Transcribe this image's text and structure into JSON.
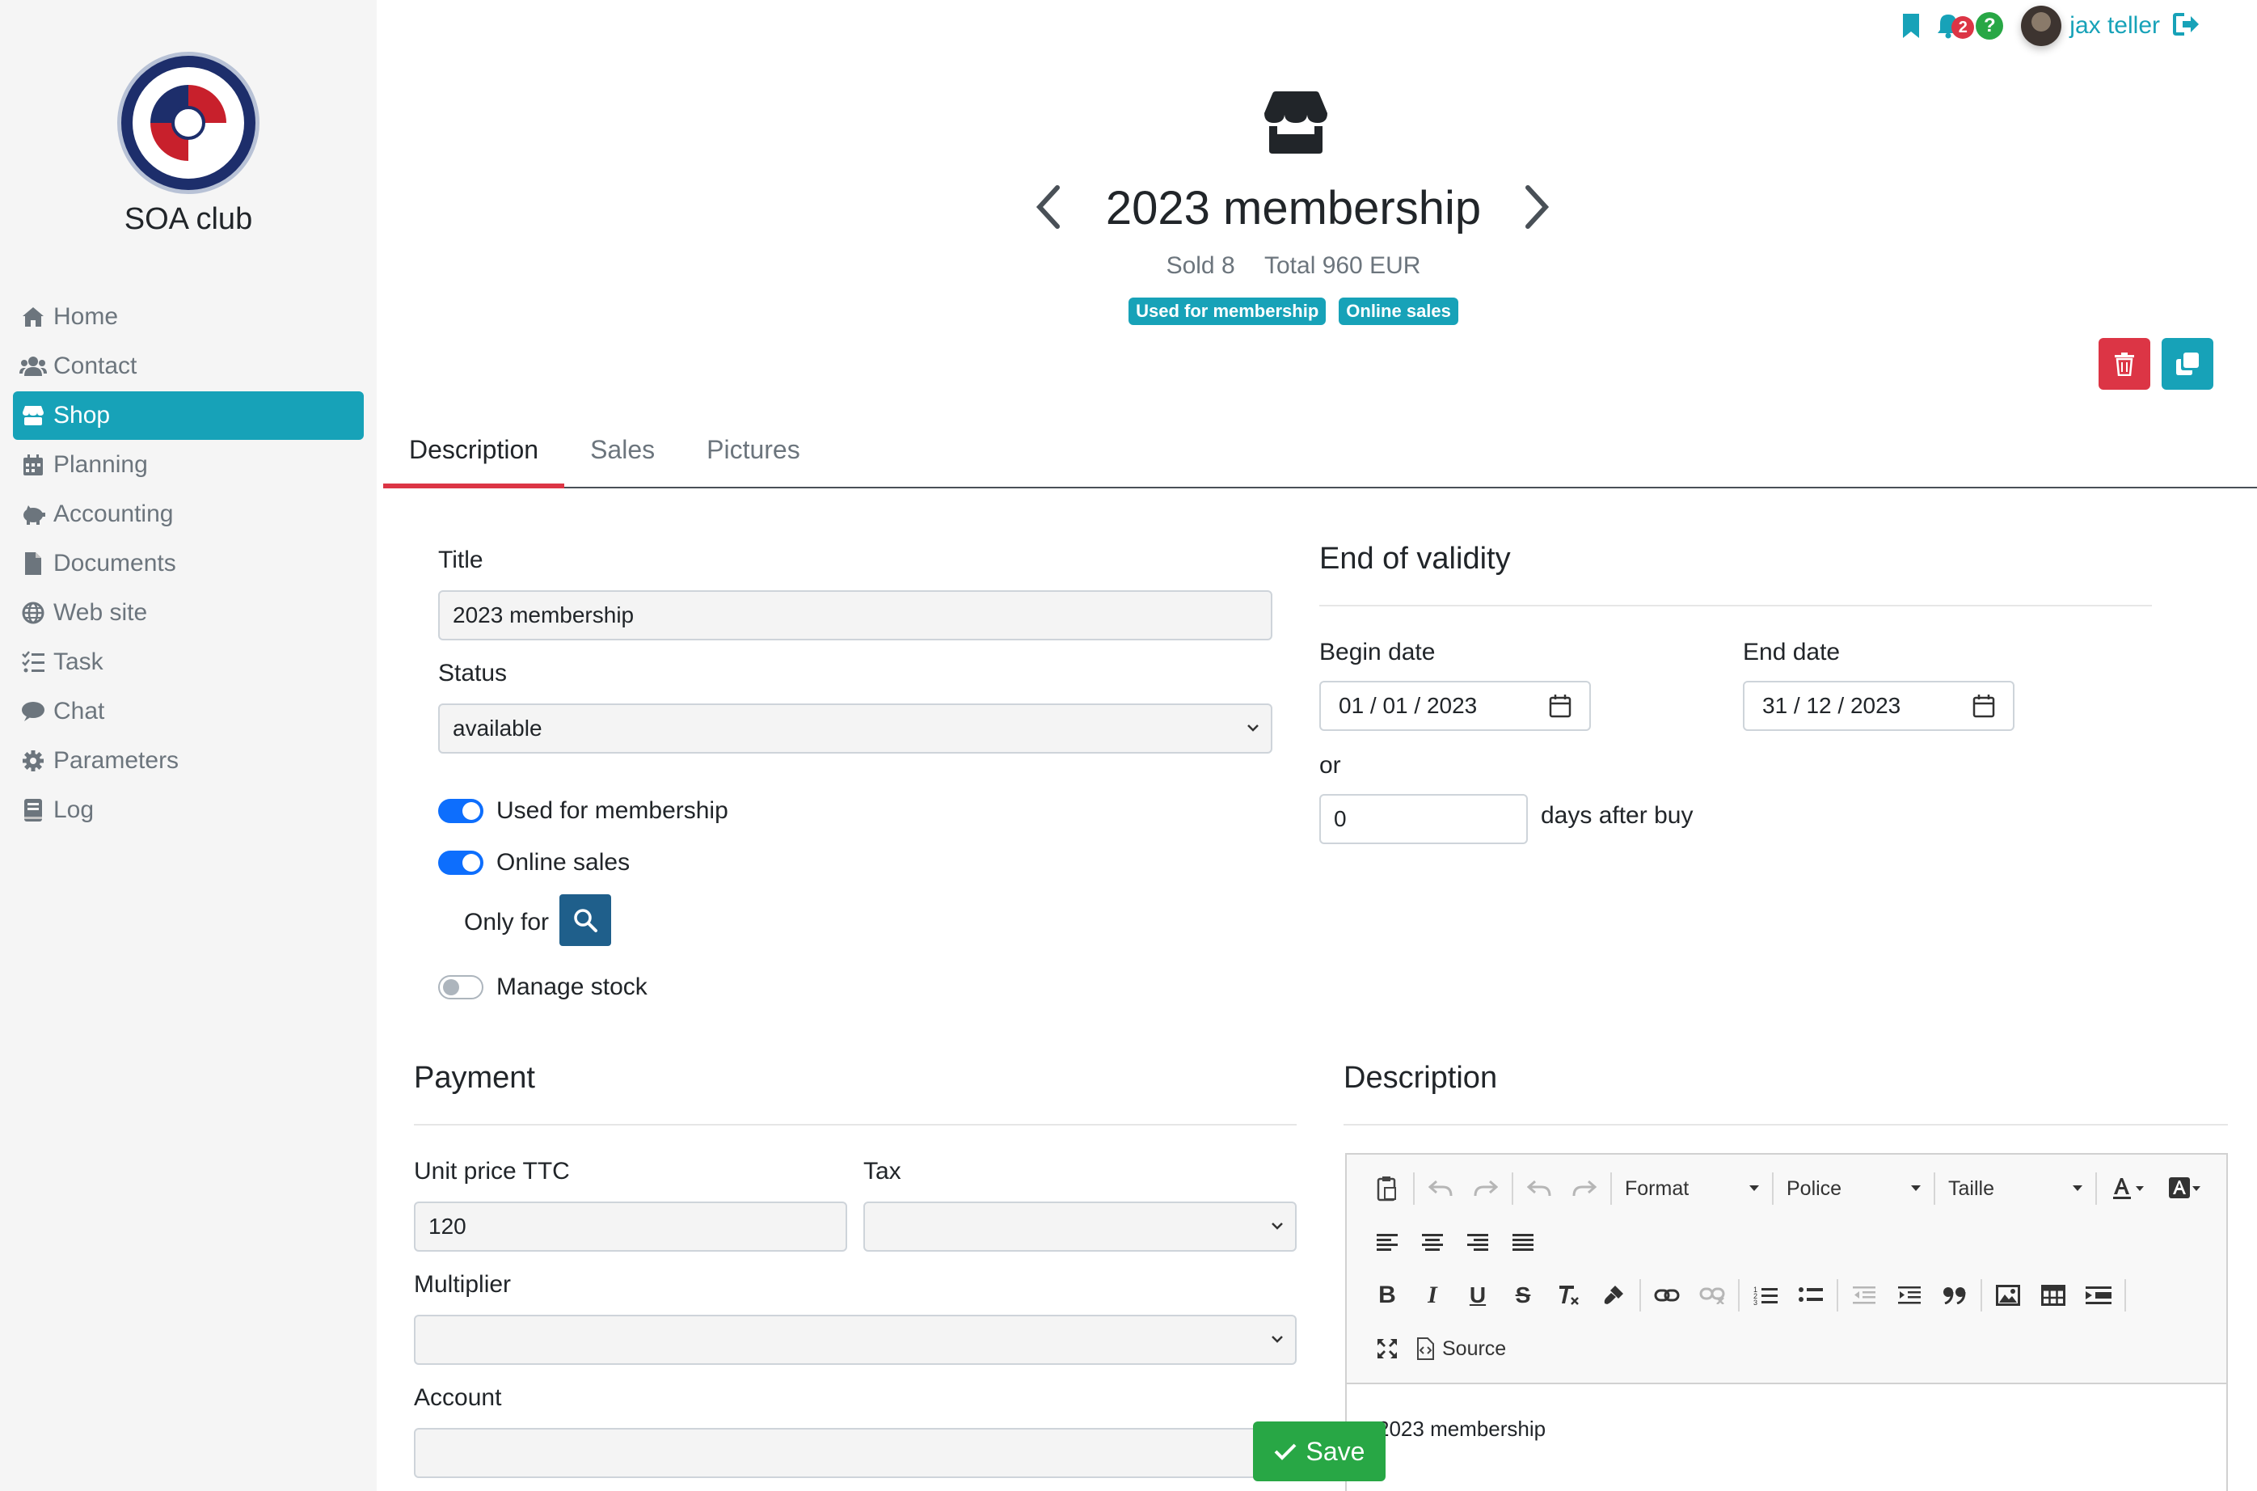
{
  "sidebar": {
    "club_name": "SOA club",
    "items": [
      {
        "label": "Home",
        "icon": "home-icon"
      },
      {
        "label": "Contact",
        "icon": "users-icon"
      },
      {
        "label": "Shop",
        "icon": "store-icon",
        "active": true
      },
      {
        "label": "Planning",
        "icon": "calendar-icon"
      },
      {
        "label": "Accounting",
        "icon": "piggy-bank-icon"
      },
      {
        "label": "Documents",
        "icon": "file-icon"
      },
      {
        "label": "Web site",
        "icon": "globe-icon"
      },
      {
        "label": "Task",
        "icon": "tasks-icon"
      },
      {
        "label": "Chat",
        "icon": "chat-icon"
      },
      {
        "label": "Parameters",
        "icon": "gear-icon"
      },
      {
        "label": "Log",
        "icon": "book-icon"
      }
    ]
  },
  "topbar": {
    "notifications_count": "2",
    "help_label": "?",
    "username": "jax teller"
  },
  "header": {
    "title": "2023 membership",
    "sold": "Sold 8",
    "total": "Total 960 EUR",
    "tags": [
      "Used for membership",
      "Online sales"
    ]
  },
  "tabs": [
    "Description",
    "Sales",
    "Pictures"
  ],
  "form": {
    "title_label": "Title",
    "title_value": "2023 membership",
    "status_label": "Status",
    "status_value": "available",
    "toggle_membership": "Used for membership",
    "toggle_online": "Online sales",
    "only_for": "Only for",
    "toggle_stock": "Manage stock"
  },
  "validity": {
    "heading": "End of validity",
    "begin_label": "Begin date",
    "begin_value": "01 / 01 / 2023",
    "end_label": "End date",
    "end_value": "31 / 12 / 2023",
    "or_label": "or",
    "days_value": "0",
    "days_suffix": "days after buy"
  },
  "payment": {
    "heading": "Payment",
    "unit_price_label": "Unit price TTC",
    "unit_price_value": "120",
    "tax_label": "Tax",
    "multiplier_label": "Multiplier",
    "account_label": "Account"
  },
  "description": {
    "heading": "Description",
    "format_label": "Format",
    "font_label": "Police",
    "size_label": "Taille",
    "source_label": "Source",
    "content": "2023 membership"
  },
  "save_label": "Save",
  "colors": {
    "accent": "#17a2b8",
    "danger": "#dc3545",
    "success": "#28a745",
    "toggle_on": "#0d6efd",
    "search_button": "#1f5f8b"
  }
}
